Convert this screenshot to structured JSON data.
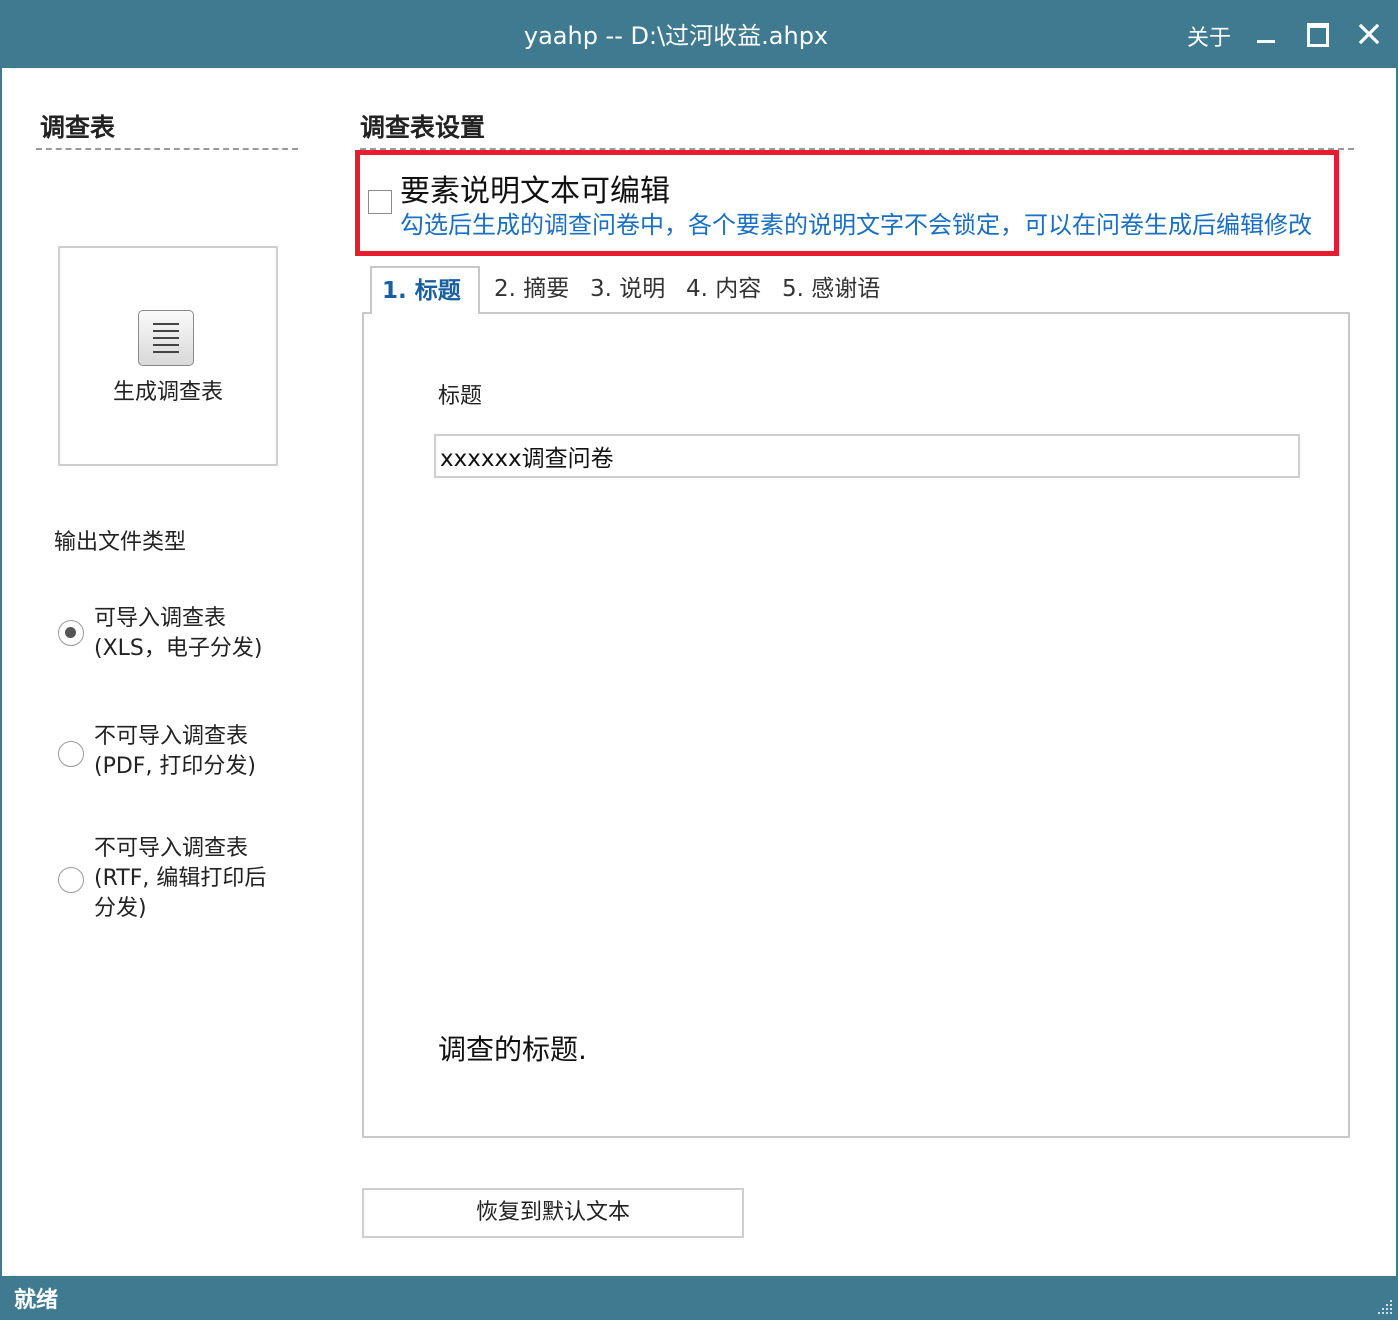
{
  "window": {
    "title": "yaahp -- D:\\过河收益.ahpx",
    "about_label": "关于",
    "controls": [
      "minimize-icon",
      "maximize-icon",
      "close-icon"
    ],
    "accent_color": "#3f7a90"
  },
  "left_panel": {
    "title": "调查表",
    "generate_button_label": "生成调查表",
    "generate_button_icon": "document-icon",
    "output_type_label": "输出文件类型",
    "output_options": [
      {
        "line1": "可导入调查表",
        "line2": "(XLS，电子分发)",
        "checked": true
      },
      {
        "line1": "不可导入调查表",
        "line2": "(PDF, 打印分发)",
        "checked": false
      },
      {
        "line1": "不可导入调查表",
        "line2": "(RTF, 编辑打印后",
        "line3": "分发)",
        "checked": false
      }
    ]
  },
  "settings": {
    "title": "调查表设置",
    "editable_checkbox_label": "要素说明文本可编辑",
    "editable_checkbox_checked": false,
    "editable_hint": "勾选后生成的调查问卷中，各个要素的说明文字不会锁定，可以在问卷生成后编辑修改",
    "highlight_color": "#e81c2e",
    "tabs": [
      {
        "label": "1.  标题",
        "active": true
      },
      {
        "label": "2. 摘要",
        "active": false
      },
      {
        "label": "3. 说明",
        "active": false
      },
      {
        "label": "4. 内容",
        "active": false
      },
      {
        "label": "5. 感谢语",
        "active": false
      }
    ],
    "field_label": "标题",
    "field_value": "xxxxxx调查问卷",
    "field_description": "调查的标题.",
    "restore_button_label": "恢复到默认文本"
  },
  "status_bar": {
    "text": "就绪"
  }
}
